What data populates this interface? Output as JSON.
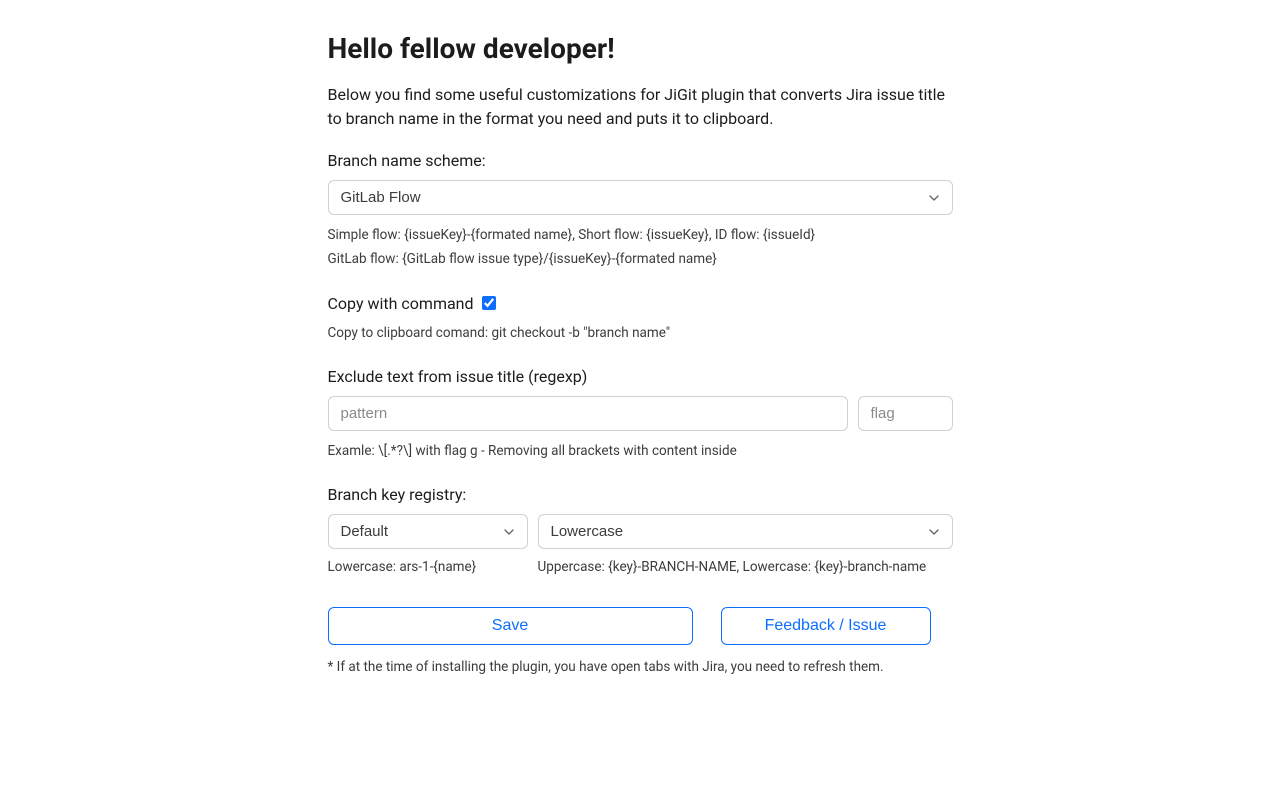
{
  "heading": "Hello fellow developer!",
  "intro": "Below you find some useful customizations for JiGit plugin that converts Jira issue title to branch name in the format you need and puts it to clipboard.",
  "scheme": {
    "label": "Branch name scheme:",
    "selected": "GitLab Flow",
    "help_line1": "Simple flow: {issueKey}-{formated name}, Short flow: {issueKey}, ID flow: {issueId}",
    "help_line2": "GitLab flow: {GitLab flow issue type}/{issueKey}-{formated name}"
  },
  "copy_cmd": {
    "label": "Copy with command",
    "checked": true,
    "help": "Copy to clipboard comand: git checkout -b \"branch name\""
  },
  "exclude": {
    "label": "Exclude text from issue title (regexp)",
    "pattern_placeholder": "pattern",
    "flag_placeholder": "flag",
    "help": "Examle: \\[.*?\\] with flag g - Removing all brackets with content inside"
  },
  "registry": {
    "label": "Branch key registry:",
    "left_selected": "Default",
    "right_selected": "Lowercase",
    "help_left": "Lowercase: ars-1-{name}",
    "help_right": "Uppercase: {key}-BRANCH-NAME, Lowercase: {key}-branch-name"
  },
  "buttons": {
    "save": "Save",
    "feedback": "Feedback / Issue"
  },
  "footnote": "* If at the time of installing the plugin, you have open tabs with Jira, you need to refresh them."
}
